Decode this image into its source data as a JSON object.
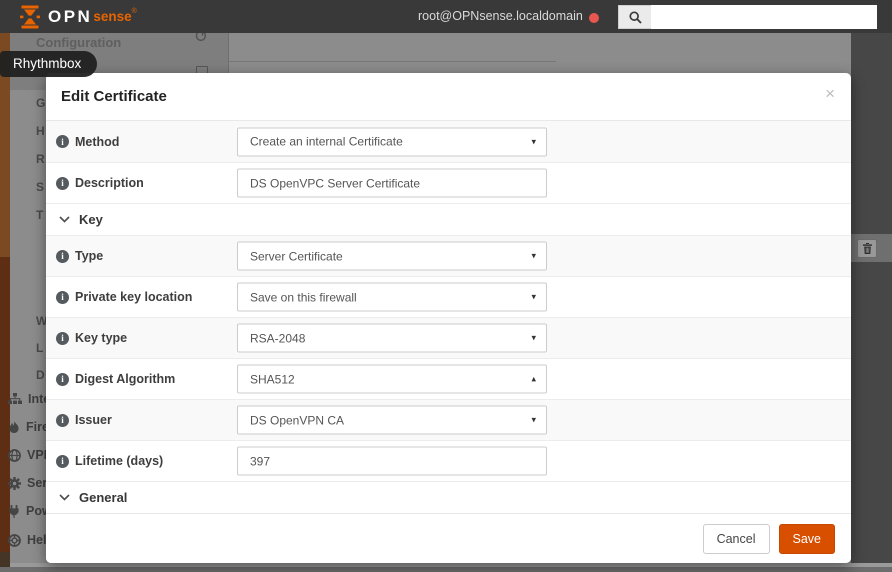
{
  "colors": {
    "accent": "#d94f00",
    "alert_dot": "#e9564f"
  },
  "desktop": {
    "tooltip_label": "Rhythmbox"
  },
  "header": {
    "logo_opn": "OPN",
    "logo_sense": "sense",
    "logo_registered": "®",
    "account": "root@OPNsense.localdomain",
    "search_placeholder": ""
  },
  "background": {
    "breadcrumb": "Configuration",
    "menu_letters": [
      "G",
      "H",
      "R",
      "S",
      "T",
      "W",
      "L",
      "D"
    ],
    "menu_items": [
      {
        "icon": "sitemap-icon",
        "label": "Inte"
      },
      {
        "icon": "fire-icon",
        "label": "Fire"
      },
      {
        "icon": "globe-icon",
        "label": "VPN"
      },
      {
        "icon": "gear-icon",
        "label": "Serv"
      },
      {
        "icon": "plug-icon",
        "label": "Pow"
      },
      {
        "icon": "life-ring-icon",
        "label": "Hel"
      }
    ]
  },
  "modal": {
    "title": "Edit Certificate",
    "close_label": "×",
    "form": {
      "rows": [
        {
          "kind": "field",
          "label": "Method",
          "control": "select",
          "value": "Create an internal Certificate",
          "caret": "▾"
        },
        {
          "kind": "field",
          "label": "Description",
          "control": "text",
          "value": "DS OpenVPC Server Certificate"
        },
        {
          "kind": "section",
          "label": "Key"
        },
        {
          "kind": "field",
          "label": "Type",
          "control": "select",
          "value": "Server Certificate",
          "caret": "▾"
        },
        {
          "kind": "field",
          "label": "Private key location",
          "control": "select",
          "value": "Save on this firewall",
          "caret": "▾"
        },
        {
          "kind": "field",
          "label": "Key type",
          "control": "select",
          "value": "RSA-2048",
          "caret": "▾"
        },
        {
          "kind": "field",
          "label": "Digest Algorithm",
          "control": "select",
          "value": "SHA512",
          "caret": "▴"
        },
        {
          "kind": "field",
          "label": "Issuer",
          "control": "select",
          "value": "DS OpenVPN CA",
          "caret": "▾"
        },
        {
          "kind": "field",
          "label": "Lifetime (days)",
          "control": "text",
          "value": "397"
        },
        {
          "kind": "section",
          "label": "General"
        }
      ],
      "cancel_label": "Cancel",
      "save_label": "Save"
    }
  }
}
